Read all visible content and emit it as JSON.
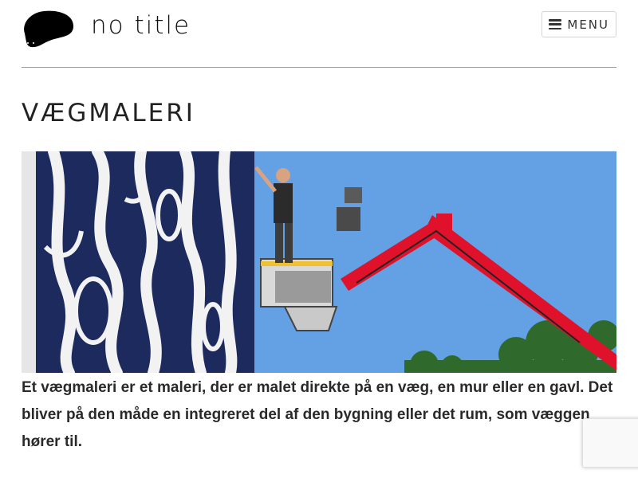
{
  "header": {
    "site_title": "no title",
    "menu_label": "MENU",
    "logo_icon": "blob-logo-icon",
    "menu_icon": "hamburger-icon"
  },
  "page": {
    "title": "VÆGMALERI"
  },
  "content": {
    "intro": "Et vægmaleri er et maleri, der er malet direkte på en væg, en mur eller en gavl. Det bliver på den måde en integreret del af den bygning eller det rum, som væggen hører til."
  },
  "colors": {
    "sky": "#5b9be0",
    "lift_red": "#e0112b",
    "mural_navy": "#1c2a5e",
    "mural_white": "#f4f4f4"
  }
}
